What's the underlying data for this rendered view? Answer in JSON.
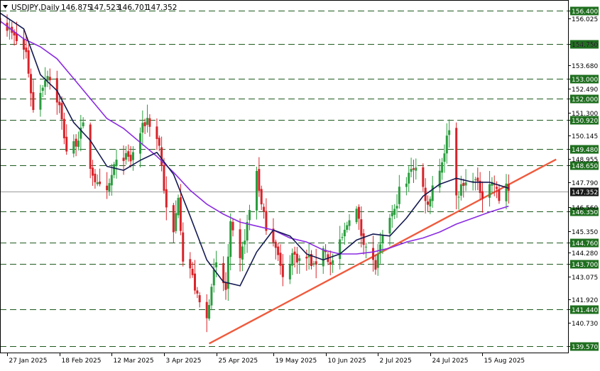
{
  "header": {
    "symbol": "USDJPY,Daily",
    "open": "146.875",
    "high": "147.523",
    "low": "146.701",
    "close": "147.352"
  },
  "colors": {
    "bull": "#2a9d3e",
    "bear": "#d8232a",
    "sma_fast": "#141a52",
    "sma_slow": "#8a2be2",
    "trendline": "#f05a3c",
    "level_line": "#1f5a1f",
    "level_tag_bg": "#1f6f1f",
    "price_tag_bg": "#1a1a1a"
  },
  "chart_data": {
    "type": "candlestick",
    "symbol": "USDJPY",
    "timeframe": "Daily",
    "ylim": [
      139.25,
      156.95
    ],
    "x_range": [
      "2025-01-24",
      "2025-09-20"
    ],
    "price_axis_ticks": [
      "156.025",
      "154.750",
      "153.680",
      "152.490",
      "151.300",
      "150.145",
      "148.955",
      "147.790",
      "146.560",
      "145.350",
      "144.280",
      "143.075",
      "141.920",
      "140.730"
    ],
    "date_axis_labels": [
      {
        "date": "2025-01-27",
        "label": "27 Jan 2025"
      },
      {
        "date": "2025-02-18",
        "label": "18 Feb 2025"
      },
      {
        "date": "2025-03-12",
        "label": "12 Mar 2025"
      },
      {
        "date": "2025-04-03",
        "label": "3 Apr 2025"
      },
      {
        "date": "2025-04-25",
        "label": "25 Apr 2025"
      },
      {
        "date": "2025-05-19",
        "label": "19 May 2025"
      },
      {
        "date": "2025-06-10",
        "label": "10 Jun 2025"
      },
      {
        "date": "2025-07-02",
        "label": "2 Jul 2025"
      },
      {
        "date": "2025-07-24",
        "label": "24 Jul 2025"
      },
      {
        "date": "2025-08-15",
        "label": "15 Aug 2025"
      }
    ],
    "horizontal_levels": [
      "156.400",
      "154.750",
      "153.000",
      "152.000",
      "150.920",
      "149.480",
      "148.650",
      "146.350",
      "144.760",
      "143.700",
      "141.440",
      "139.570"
    ],
    "current_price": "147.352",
    "trendline": {
      "from": {
        "date": "2025-04-22",
        "price": 139.7
      },
      "to": {
        "date": "2025-09-15",
        "price": 148.95
      }
    },
    "close_path": [
      [
        "2025-01-24",
        156.0
      ],
      [
        "2025-01-28",
        155.4
      ],
      [
        "2025-01-31",
        154.9
      ],
      [
        "2025-02-04",
        154.3
      ],
      [
        "2025-02-07",
        151.4
      ],
      [
        "2025-02-10",
        152.4
      ],
      [
        "2025-02-13",
        153.3
      ],
      [
        "2025-02-18",
        151.6
      ],
      [
        "2025-02-21",
        149.4
      ],
      [
        "2025-02-25",
        149.8
      ],
      [
        "2025-02-28",
        150.6
      ],
      [
        "2025-03-03",
        148.6
      ],
      [
        "2025-03-06",
        147.6
      ],
      [
        "2025-03-10",
        147.2
      ],
      [
        "2025-03-13",
        148.6
      ],
      [
        "2025-03-17",
        149.1
      ],
      [
        "2025-03-20",
        148.9
      ],
      [
        "2025-03-24",
        150.3
      ],
      [
        "2025-03-27",
        151.0
      ],
      [
        "2025-04-01",
        149.7
      ],
      [
        "2025-04-04",
        146.4
      ],
      [
        "2025-04-07",
        145.2
      ],
      [
        "2025-04-09",
        147.2
      ],
      [
        "2025-04-11",
        144.0
      ],
      [
        "2025-04-14",
        143.5
      ],
      [
        "2025-04-17",
        142.0
      ],
      [
        "2025-04-21",
        140.9
      ],
      [
        "2025-04-23",
        142.8
      ],
      [
        "2025-04-25",
        143.6
      ],
      [
        "2025-04-29",
        142.4
      ],
      [
        "2025-05-01",
        145.6
      ],
      [
        "2025-05-05",
        143.8
      ],
      [
        "2025-05-08",
        145.7
      ],
      [
        "2025-05-12",
        148.4
      ],
      [
        "2025-05-14",
        146.6
      ],
      [
        "2025-05-16",
        145.6
      ],
      [
        "2025-05-20",
        144.7
      ],
      [
        "2025-05-23",
        142.9
      ],
      [
        "2025-05-27",
        144.2
      ],
      [
        "2025-05-30",
        143.9
      ],
      [
        "2025-06-03",
        144.0
      ],
      [
        "2025-06-05",
        143.5
      ],
      [
        "2025-06-09",
        144.6
      ],
      [
        "2025-06-12",
        143.6
      ],
      [
        "2025-06-16",
        144.7
      ],
      [
        "2025-06-18",
        145.3
      ],
      [
        "2025-06-20",
        146.1
      ],
      [
        "2025-06-23",
        146.4
      ],
      [
        "2025-06-25",
        145.2
      ],
      [
        "2025-06-27",
        144.6
      ],
      [
        "2025-07-01",
        143.5
      ],
      [
        "2025-07-03",
        144.5
      ],
      [
        "2025-07-07",
        146.1
      ],
      [
        "2025-07-09",
        146.3
      ],
      [
        "2025-07-11",
        147.4
      ],
      [
        "2025-07-14",
        147.7
      ],
      [
        "2025-07-16",
        148.6
      ],
      [
        "2025-07-18",
        148.5
      ],
      [
        "2025-07-21",
        147.5
      ],
      [
        "2025-07-23",
        146.6
      ],
      [
        "2025-07-25",
        147.7
      ],
      [
        "2025-07-28",
        148.4
      ],
      [
        "2025-07-30",
        149.4
      ],
      [
        "2025-08-01",
        150.6
      ],
      [
        "2025-08-04",
        147.1
      ],
      [
        "2025-08-06",
        147.5
      ],
      [
        "2025-08-08",
        147.7
      ],
      [
        "2025-08-11",
        148.1
      ],
      [
        "2025-08-13",
        147.6
      ],
      [
        "2025-08-15",
        147.2
      ],
      [
        "2025-08-18",
        147.8
      ],
      [
        "2025-08-20",
        147.7
      ],
      [
        "2025-08-22",
        146.9
      ],
      [
        "2025-08-25",
        147.8
      ],
      [
        "2025-08-26",
        147.35
      ]
    ],
    "sma_fast_path": [
      [
        "2025-01-24",
        156.3
      ],
      [
        "2025-02-03",
        155.5
      ],
      [
        "2025-02-10",
        153.2
      ],
      [
        "2025-02-17",
        152.4
      ],
      [
        "2025-02-24",
        150.8
      ],
      [
        "2025-03-03",
        149.9
      ],
      [
        "2025-03-10",
        148.6
      ],
      [
        "2025-03-17",
        148.4
      ],
      [
        "2025-03-24",
        148.9
      ],
      [
        "2025-03-31",
        149.3
      ],
      [
        "2025-04-07",
        148.2
      ],
      [
        "2025-04-14",
        146.1
      ],
      [
        "2025-04-21",
        143.9
      ],
      [
        "2025-04-28",
        142.8
      ],
      [
        "2025-05-05",
        142.6
      ],
      [
        "2025-05-12",
        144.3
      ],
      [
        "2025-05-19",
        145.4
      ],
      [
        "2025-05-26",
        145.1
      ],
      [
        "2025-06-02",
        144.2
      ],
      [
        "2025-06-09",
        143.9
      ],
      [
        "2025-06-16",
        144.2
      ],
      [
        "2025-06-23",
        144.9
      ],
      [
        "2025-06-30",
        145.2
      ],
      [
        "2025-07-07",
        145.1
      ],
      [
        "2025-07-14",
        146.0
      ],
      [
        "2025-07-21",
        147.1
      ],
      [
        "2025-07-28",
        147.7
      ],
      [
        "2025-08-04",
        148.0
      ],
      [
        "2025-08-11",
        147.8
      ],
      [
        "2025-08-18",
        147.8
      ],
      [
        "2025-08-26",
        147.5
      ]
    ],
    "sma_slow_path": [
      [
        "2025-01-24",
        155.9
      ],
      [
        "2025-02-03",
        155.0
      ],
      [
        "2025-02-10",
        154.6
      ],
      [
        "2025-02-17",
        154.0
      ],
      [
        "2025-02-24",
        153.0
      ],
      [
        "2025-03-03",
        152.0
      ],
      [
        "2025-03-10",
        151.0
      ],
      [
        "2025-03-17",
        150.5
      ],
      [
        "2025-03-24",
        149.8
      ],
      [
        "2025-03-31",
        149.1
      ],
      [
        "2025-04-07",
        148.3
      ],
      [
        "2025-04-14",
        147.4
      ],
      [
        "2025-04-21",
        146.7
      ],
      [
        "2025-04-28",
        146.2
      ],
      [
        "2025-05-05",
        145.8
      ],
      [
        "2025-05-12",
        145.6
      ],
      [
        "2025-05-19",
        145.4
      ],
      [
        "2025-05-26",
        145.0
      ],
      [
        "2025-06-02",
        144.8
      ],
      [
        "2025-06-09",
        144.4
      ],
      [
        "2025-06-16",
        144.2
      ],
      [
        "2025-06-23",
        144.2
      ],
      [
        "2025-06-30",
        144.3
      ],
      [
        "2025-07-07",
        144.5
      ],
      [
        "2025-07-14",
        144.8
      ],
      [
        "2025-07-21",
        145.0
      ],
      [
        "2025-07-28",
        145.3
      ],
      [
        "2025-08-04",
        145.7
      ],
      [
        "2025-08-11",
        146.0
      ],
      [
        "2025-08-18",
        146.3
      ],
      [
        "2025-08-26",
        146.6
      ]
    ]
  }
}
